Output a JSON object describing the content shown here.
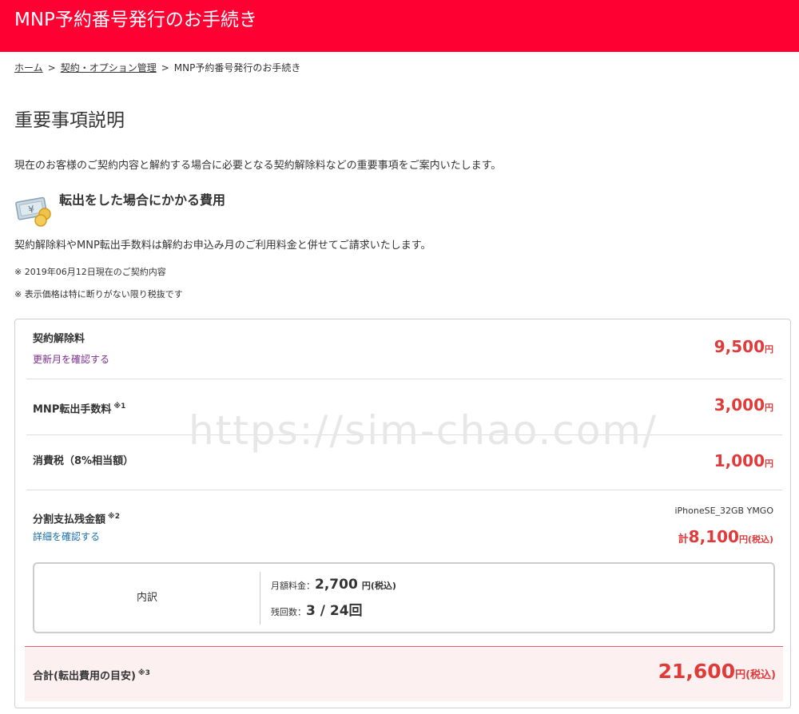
{
  "header": {
    "title": "MNP予約番号発行のお手続き"
  },
  "colors": {
    "header_bg": "#ff0033",
    "accent_red": "#e03b3b",
    "link_purple": "#7b2d8e",
    "link_blue": "#1a6fa8",
    "total_bg": "#fdf0f1"
  },
  "breadcrumb": {
    "items": [
      "ホーム",
      "契約・オプション管理"
    ],
    "separator": ">",
    "current": "MNP予約番号発行のお手続き"
  },
  "page": {
    "title": "重要事項説明",
    "intro": "現在のお客様のご契約内容と解約する場合に必要となる契約解除料などの重要事項をご案内いたします。",
    "section_heading": "転出をした場合にかかる費用",
    "section_icon": "money-icon",
    "billing_note": "契約解除料やMNP転出手数料は解約お申込み月のご利用料金と併せてご請求いたします。",
    "notes": [
      "※ 2019年06月12日現在のご契約内容",
      "※ 表示価格は特に断りがない限り税抜です"
    ]
  },
  "fees": {
    "cancellation": {
      "label": "契約解除料",
      "link": "更新月を確認する",
      "amount": "9,500",
      "unit": "円"
    },
    "mnp": {
      "label": "MNP転出手数料",
      "sup": "※1",
      "amount": "3,000",
      "unit": "円"
    },
    "tax": {
      "label": "消費税（8%相当額）",
      "amount": "1,000",
      "unit": "円"
    },
    "installment": {
      "label": "分割支払残金額",
      "sup": "※2",
      "link": "詳細を確認する",
      "product": "iPhoneSE_32GB YMGO",
      "prefix": "計",
      "amount": "8,100",
      "unit": "円(税込)"
    }
  },
  "breakdown": {
    "label": "内訳",
    "monthly_key": "月額料金：",
    "monthly_value": "2,700",
    "monthly_suffix": "円(税込)",
    "remaining_key": "残回数：",
    "remaining_value": "3 / 24回"
  },
  "total": {
    "label": "合計(転出費用の目安)",
    "sup": "※3",
    "amount": "21,600",
    "unit": "円(税込)"
  },
  "watermark": "https://sim-chao.com/"
}
